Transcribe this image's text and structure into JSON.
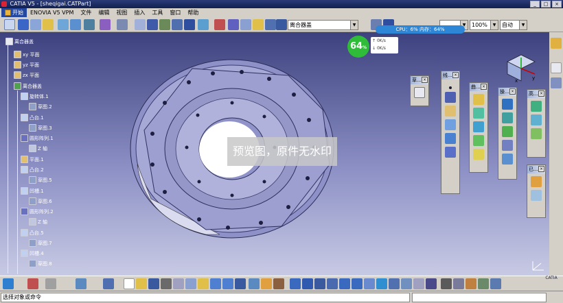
{
  "window": {
    "title": "CATIA V5 - [sheqigai.CATPart]",
    "buttons": [
      "_",
      "□",
      "×"
    ]
  },
  "menu": {
    "items": [
      "开始",
      "ENOVIA V5 VPM",
      "文件",
      "编辑",
      "视图",
      "插入",
      "工具",
      "窗口",
      "帮助"
    ]
  },
  "toolbar": {
    "combo_body": "离合器盖",
    "combo_zoom": "100%",
    "combo_mode": "自动"
  },
  "perf": {
    "text": "CPU：6%   内存：64%"
  },
  "gauge": {
    "value": "64",
    "unit": "%",
    "up": "0K/s",
    "down": "0K/s"
  },
  "watermark": "预览图，原件无水印",
  "tree": {
    "root": "离合器盖",
    "planes": [
      "xy 平面",
      "yz 平面",
      "zx 平面"
    ],
    "body": "离合器盖",
    "features": [
      {
        "label": "旋转体.1"
      },
      {
        "label": "草图.2"
      },
      {
        "label": "凸台.1"
      },
      {
        "label": "草图.3"
      },
      {
        "label": "圆形阵列.1"
      },
      {
        "label": "Z 轴"
      },
      {
        "label": "平面.1"
      },
      {
        "label": "凸台.2"
      },
      {
        "label": "草图.5"
      },
      {
        "label": "凹槽.1"
      },
      {
        "label": "草图.6"
      },
      {
        "label": "圆形阵列.2"
      },
      {
        "label": "Z 轴"
      },
      {
        "label": "凸台.5"
      },
      {
        "label": "草图.7"
      },
      {
        "label": "凹槽.4"
      },
      {
        "label": "草图.8"
      }
    ]
  },
  "palettes": [
    {
      "title": "草..."
    },
    {
      "title": "线..."
    },
    {
      "title": "曲..."
    },
    {
      "title": "操..."
    },
    {
      "title": "高..."
    },
    {
      "title": "已..."
    }
  ],
  "status": {
    "prompt": "选择对象或命令",
    "command": ""
  },
  "logo": {
    "text": "CATIA"
  }
}
